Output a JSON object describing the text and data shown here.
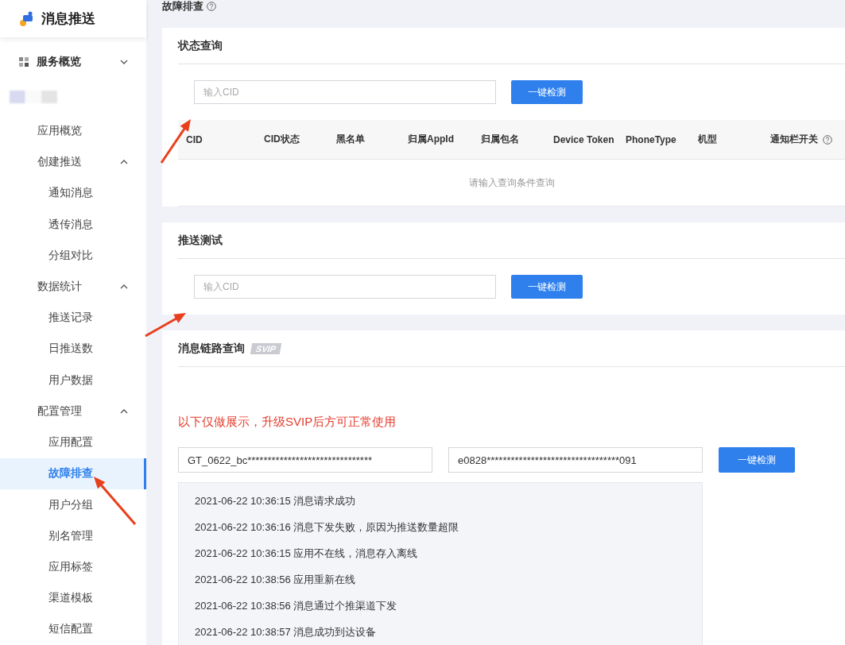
{
  "brand": {
    "title": "消息推送"
  },
  "sidebar": {
    "items": [
      {
        "label": "服务概览",
        "kind": "section",
        "expanded": false
      },
      {
        "label": "应用概览",
        "kind": "link",
        "selected": false
      },
      {
        "label": "创建推送",
        "kind": "group",
        "expanded": true,
        "children": [
          {
            "label": "通知消息",
            "selected": false
          },
          {
            "label": "透传消息",
            "selected": false
          },
          {
            "label": "分组对比",
            "selected": false
          }
        ]
      },
      {
        "label": "数据统计",
        "kind": "group",
        "expanded": true,
        "children": [
          {
            "label": "推送记录",
            "selected": false
          },
          {
            "label": "日推送数",
            "selected": false
          },
          {
            "label": "用户数据",
            "selected": false
          }
        ]
      },
      {
        "label": "配置管理",
        "kind": "group",
        "expanded": true,
        "children": [
          {
            "label": "应用配置",
            "selected": false
          },
          {
            "label": "故障排查",
            "selected": true
          },
          {
            "label": "用户分组",
            "selected": false
          },
          {
            "label": "别名管理",
            "selected": false
          },
          {
            "label": "应用标签",
            "selected": false
          },
          {
            "label": "渠道模板",
            "selected": false
          },
          {
            "label": "短信配置",
            "selected": false
          }
        ]
      }
    ]
  },
  "page_title": "故障排查",
  "status_query": {
    "title": "状态查询",
    "placeholder": "输入CID",
    "button": "一键检测",
    "table": {
      "columns": [
        {
          "label": "CID",
          "help": false
        },
        {
          "label": "CID状态",
          "help": false
        },
        {
          "label": "黑名单",
          "help": false
        },
        {
          "label": "归属AppId",
          "help": false
        },
        {
          "label": "归属包名",
          "help": false
        },
        {
          "label": "Device Token",
          "help": false
        },
        {
          "label": "PhoneType",
          "help": false
        },
        {
          "label": "机型",
          "help": false
        },
        {
          "label": "通知栏开关",
          "help": true
        }
      ],
      "empty": "请输入查询条件查询"
    }
  },
  "push_test": {
    "title": "推送测试",
    "placeholder": "输入CID",
    "button": "一键检测"
  },
  "trace": {
    "title": "消息链路查询",
    "badge": "SVIP",
    "notice": "以下仅做展示，升级SVIP后方可正常使用",
    "cid_value": "GT_0622_bc*******************************",
    "task_value": "e0828*********************************091",
    "button": "一键检测",
    "log": [
      "2021-06-22 10:36:15 消息请求成功",
      "2021-06-22 10:36:16 消息下发失败，原因为推送数量超限",
      "2021-06-22 10:36:15 应用不在线，消息存入离线",
      "2021-06-22 10:38:56 应用重新在线",
      "2021-06-22 10:38:56 消息通过个推渠道下发",
      "2021-06-22 10:38:57 消息成功到达设备"
    ]
  }
}
